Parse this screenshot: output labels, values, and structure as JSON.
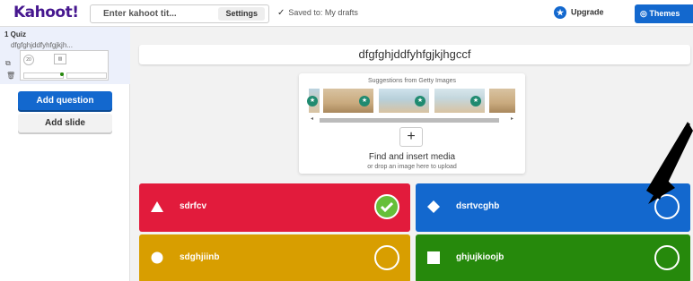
{
  "header": {
    "logo": "Kahoot!",
    "title_placeholder": "Enter kahoot tit...",
    "settings_label": "Settings",
    "saved_status": "Saved to: My drafts",
    "upgrade_label": "Upgrade",
    "themes_label": "Themes"
  },
  "sidebar": {
    "slide_label": "1 Quiz",
    "slide_title": "dfgfghjddfyhfgjkjh...",
    "thumb_timer": "20",
    "add_question_label": "Add question",
    "add_slide_label": "Add slide"
  },
  "question": {
    "text": "dfgfghjddfyhfgjkjhgccf"
  },
  "media": {
    "suggestions_title": "Suggestions from Getty Images",
    "find_label": "Find and insert media",
    "drop_label": "or drop an image here to upload"
  },
  "answers": [
    {
      "text": "sdrfcv",
      "shape": "triangle",
      "color": "#e21b3c",
      "correct": true
    },
    {
      "text": "dsrtvcghb",
      "shape": "diamond",
      "color": "#1368ce",
      "correct": false
    },
    {
      "text": "sdghjiinb",
      "shape": "circle",
      "color": "#d89e00",
      "correct": false
    },
    {
      "text": "ghjujkioojb",
      "shape": "square",
      "color": "#26890c",
      "correct": false
    }
  ],
  "icons": {
    "upgrade": "star-icon",
    "themes": "palette-icon",
    "saved": "check-icon",
    "duplicate": "duplicate-icon",
    "delete": "trash-icon"
  }
}
